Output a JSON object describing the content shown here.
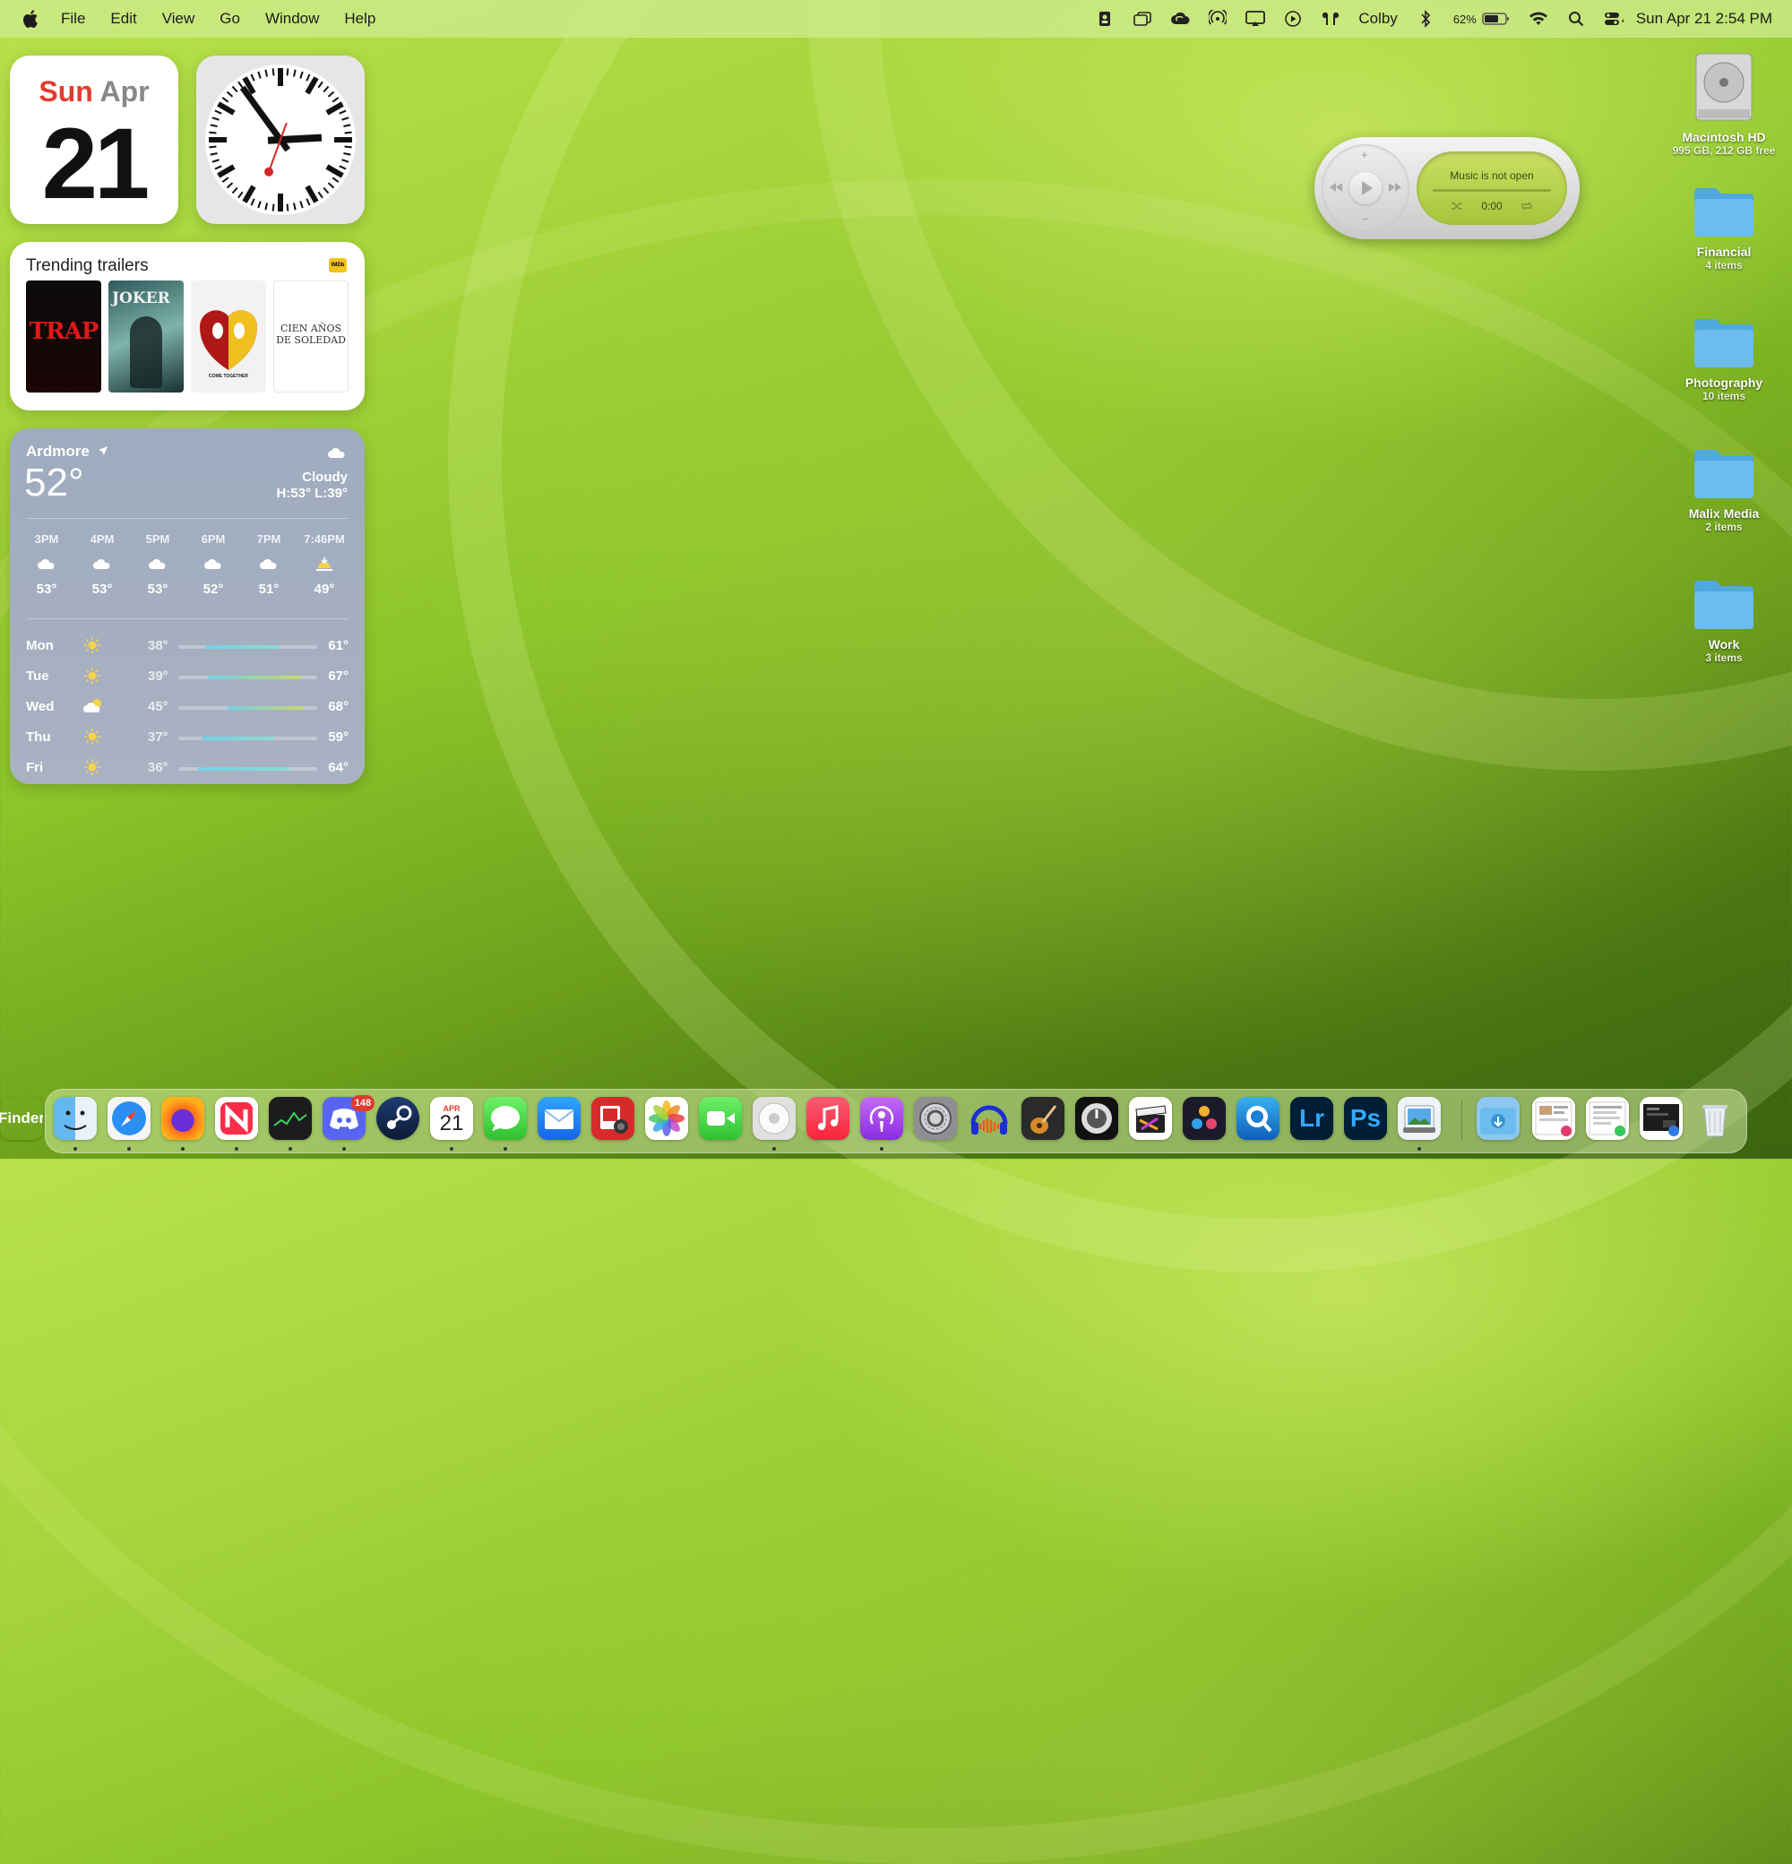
{
  "menubar": {
    "app_name": "Finder",
    "menus": [
      "File",
      "Edit",
      "View",
      "Go",
      "Window",
      "Help"
    ],
    "user": "Colby",
    "battery_percent": "62%",
    "datetime": "Sun Apr 21  2:54 PM"
  },
  "calendar_widget": {
    "weekday": "Sun",
    "month": "Apr",
    "day": "21"
  },
  "clock_widget": {
    "time": "2:54"
  },
  "trailers_widget": {
    "title": "Trending trailers",
    "source": "IMDb",
    "posters": [
      "TRAP",
      "JOKER",
      "COME TOGETHER",
      "CIEN AÑOS DE SOLEDAD"
    ]
  },
  "weather": {
    "location": "Ardmore",
    "temperature": "52°",
    "condition": "Cloudy",
    "high_low": "H:53° L:39°",
    "hourly": [
      {
        "time": "3PM",
        "temp": "53°",
        "icon": "cloud-icon"
      },
      {
        "time": "4PM",
        "temp": "53°",
        "icon": "cloud-icon"
      },
      {
        "time": "5PM",
        "temp": "53°",
        "icon": "cloud-icon"
      },
      {
        "time": "6PM",
        "temp": "52°",
        "icon": "cloud-icon"
      },
      {
        "time": "7PM",
        "temp": "51°",
        "icon": "cloud-icon"
      },
      {
        "time": "7:46PM",
        "temp": "49°",
        "icon": "sunset-icon"
      }
    ],
    "daily": [
      {
        "day": "Mon",
        "low": "38°",
        "high": "61°",
        "icon": "sun-icon"
      },
      {
        "day": "Tue",
        "low": "39°",
        "high": "67°",
        "icon": "sun-icon"
      },
      {
        "day": "Wed",
        "low": "45°",
        "high": "68°",
        "icon": "partly-cloudy-icon"
      },
      {
        "day": "Thu",
        "low": "37°",
        "high": "59°",
        "icon": "sun-icon"
      },
      {
        "day": "Fri",
        "low": "36°",
        "high": "64°",
        "icon": "sun-icon"
      }
    ]
  },
  "music_widget": {
    "message": "Music is not open",
    "time": "0:00"
  },
  "desktop_items": [
    {
      "name": "Macintosh HD",
      "detail": "995 GB, 212 GB free",
      "type": "drive"
    },
    {
      "name": "Financial",
      "detail": "4 items",
      "type": "folder"
    },
    {
      "name": "Photography",
      "detail": "10 items",
      "type": "folder"
    },
    {
      "name": "Malix Media",
      "detail": "2 items",
      "type": "folder"
    },
    {
      "name": "Work",
      "detail": "3 items",
      "type": "folder"
    }
  ],
  "dock": {
    "calendar_month": "APR",
    "calendar_day": "21",
    "discord_badge": "148",
    "lightroom_label": "Lr",
    "photoshop_label": "Ps",
    "apps": [
      "Finder",
      "Safari",
      "Firefox",
      "News",
      "Stocks",
      "Discord",
      "Steam",
      "Calendar",
      "Messages",
      "Mail",
      "Photo Booth",
      "Photos",
      "FaceTime",
      "Image Capture",
      "Music",
      "Podcasts",
      "System Settings",
      "Audacity",
      "GarageBand",
      "Logic Pro",
      "Final Cut Pro",
      "DaVinci Resolve",
      "QuickTime Player",
      "Lightroom",
      "Photoshop",
      "Preview",
      "Downloads",
      "Recent Document 1",
      "Recent Document 2",
      "Recent Document 3",
      "Trash"
    ]
  }
}
